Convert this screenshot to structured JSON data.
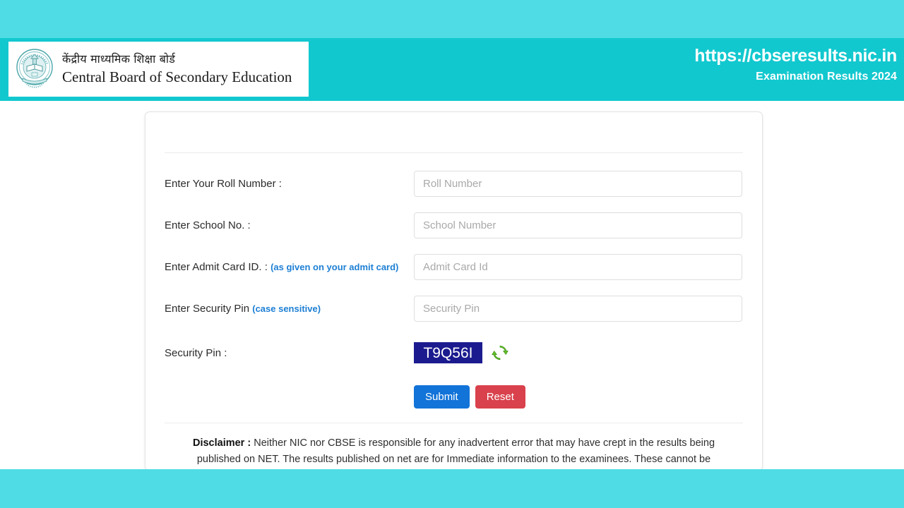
{
  "header": {
    "logo_hindi": "केंद्रीय माध्यमिक शिक्षा बोर्ड",
    "logo_english": "Central Board of Secondary Education",
    "logo_emblem_name": "cbse-emblem-icon",
    "url": "https://cbseresults.nic.in",
    "subtitle": "Examination Results 2024",
    "bar_color": "#12c8cf",
    "band_color": "#4fdce4"
  },
  "form": {
    "rows": [
      {
        "label": "Enter Your Roll Number :",
        "hint": "",
        "placeholder": "Roll Number",
        "value": ""
      },
      {
        "label": "Enter School No. :",
        "hint": "",
        "placeholder": "School Number",
        "value": ""
      },
      {
        "label": "Enter Admit Card ID. :",
        "hint": "(as given on your admit card)",
        "placeholder": "Admit Card Id",
        "value": ""
      },
      {
        "label": "Enter Security Pin",
        "hint": "(case sensitive)",
        "placeholder": "Security Pin",
        "value": ""
      }
    ],
    "captcha": {
      "label": "Security Pin :",
      "code": "T9Q56I",
      "background": "#1b1b8f",
      "refresh_icon": "refresh-icon",
      "refresh_color": "#5cb82a"
    },
    "buttons": {
      "submit": "Submit",
      "submit_color": "#1273d8",
      "reset": "Reset",
      "reset_color": "#d9414c"
    }
  },
  "disclaimer": {
    "title": "Disclaimer :",
    "body": " Neither NIC nor CBSE is responsible for any inadvertent error that may have crept in the results being published on NET. The results published on net are for Immediate information to the examinees. These cannot be treated as original mark sheets. Original mark sheets have been issued by the Board separately."
  }
}
